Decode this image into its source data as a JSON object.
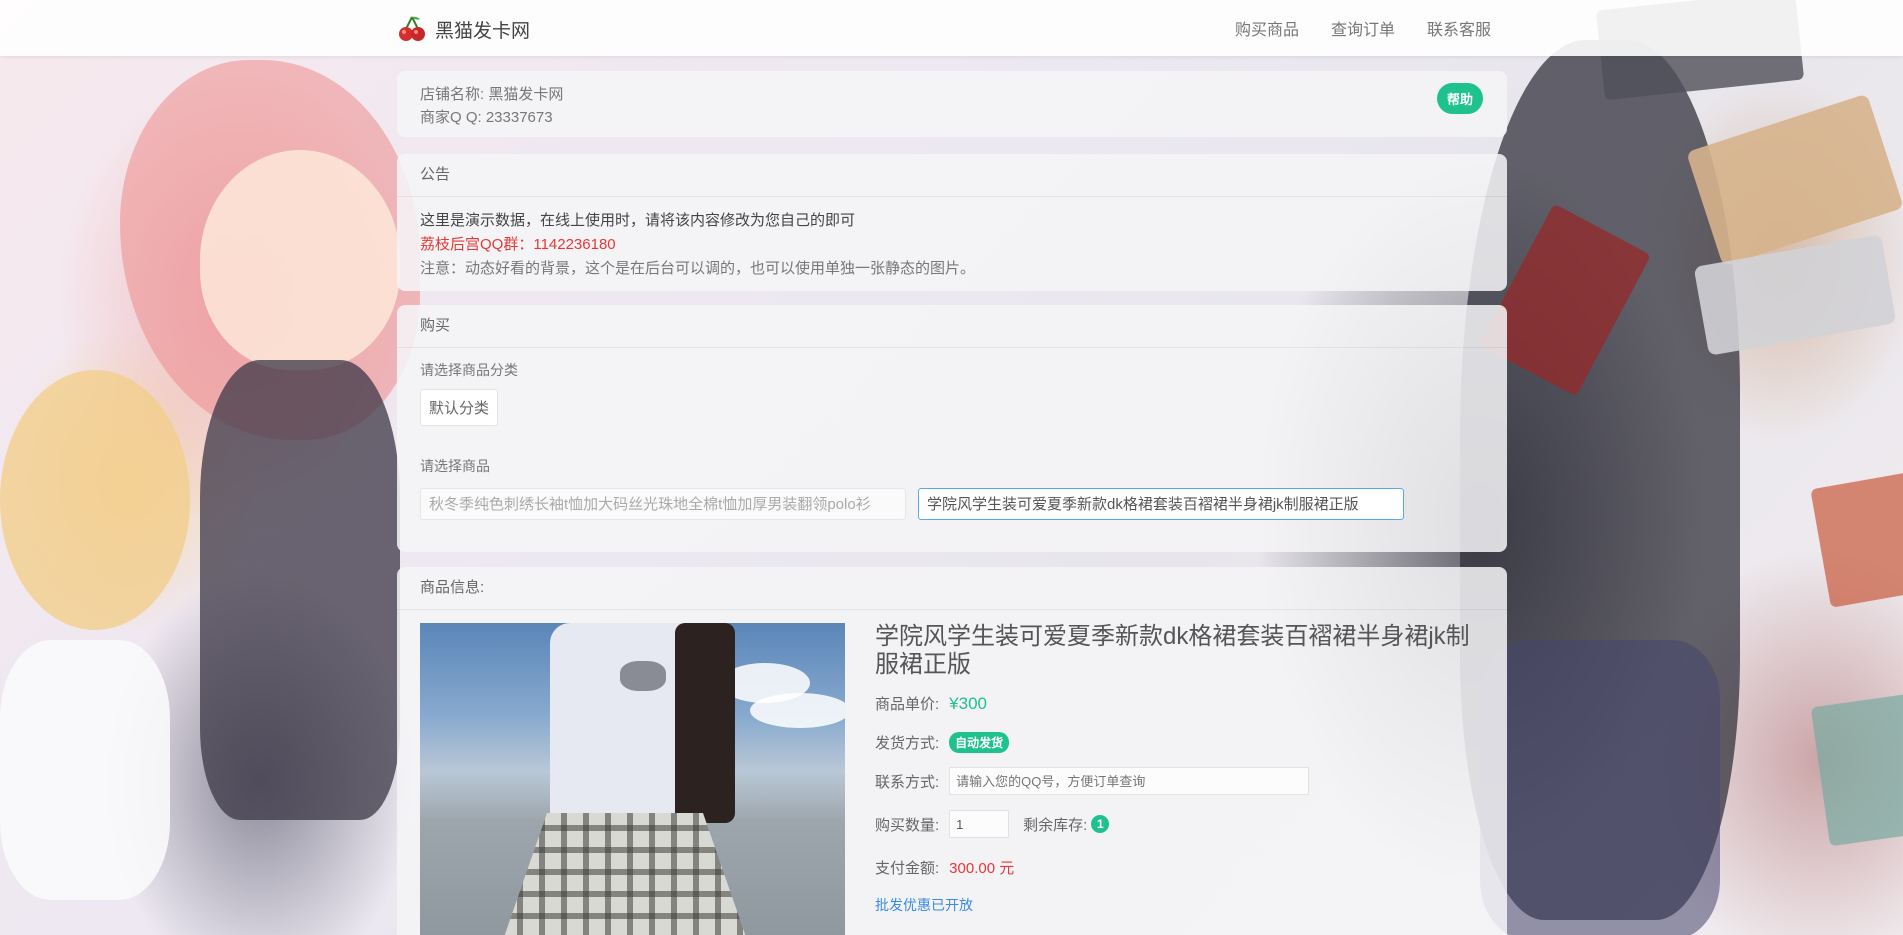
{
  "navbar": {
    "brand": "黑猫发卡网",
    "links": [
      "购买商品",
      "查询订单",
      "联系客服"
    ]
  },
  "shop": {
    "name_line": "店铺名称: 黑猫发卡网",
    "qq_line": "商家Q Q: 23337673",
    "help_label": "帮助"
  },
  "notice": {
    "title": "公告",
    "main": "这里是演示数据，在线上使用时，请将该内容修改为您自己的即可",
    "qq_group": "荔枝后宫QQ群：1142236180",
    "tip": "注意：动态好看的背景，这个是在后台可以调的，也可以使用单独一张静态的图片。"
  },
  "buy": {
    "title": "购买",
    "category_label": "请选择商品分类",
    "category_selected": "默认分类",
    "goods_label": "请选择商品",
    "goods": [
      {
        "name": "秋冬季纯色刺绣长袖t恤加大码丝光珠地全棉t恤加厚男装翻领polo衫",
        "selected": false
      },
      {
        "name": "学院风学生装可爱夏季新款dk格裙套装百褶裙半身裙jk制服裙正版",
        "selected": true
      }
    ]
  },
  "info": {
    "title": "商品信息:",
    "product_title": "学院风学生装可爱夏季新款dk格裙套装百褶裙半身裙jk制服裙正版",
    "price_label": "商品单价:",
    "price": "¥300",
    "delivery_label": "发货方式:",
    "delivery_badge": "自动发货",
    "contact_label": "联系方式:",
    "contact_placeholder": "请输入您的QQ号，方便订单查询",
    "qty_label": "购买数量:",
    "qty_value": "1",
    "stock_label": "剩余库存:",
    "stock_value": "1",
    "amount_label": "支付金额:",
    "amount": "300.00 元",
    "discount_link": "批发优惠已开放"
  },
  "colors": {
    "accent": "#1fc28c",
    "danger": "#e53935",
    "link": "#3a8be0"
  }
}
